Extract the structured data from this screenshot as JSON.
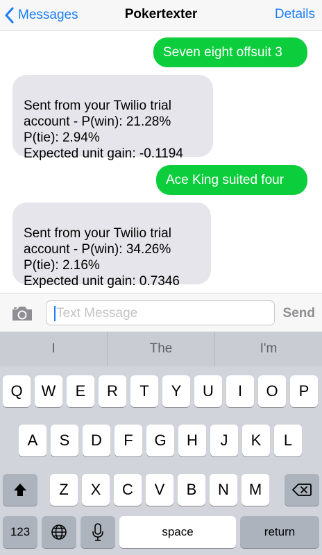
{
  "navbar": {
    "back_label": "Messages",
    "title": "Pokertexter",
    "details_label": "Details"
  },
  "messages": [
    {
      "direction": "outgoing",
      "text": "Seven eight offsuit 3"
    },
    {
      "direction": "incoming",
      "text": "Sent from your Twilio trial\naccount - P(win): 21.28%\nP(tie): 2.94%\nExpected unit gain: -0.1194"
    },
    {
      "direction": "outgoing",
      "text": "Ace King suited four"
    },
    {
      "direction": "incoming",
      "text": "Sent from your Twilio trial\naccount - P(win): 34.26%\nP(tie): 2.16%\nExpected unit gain: 0.7346"
    }
  ],
  "input": {
    "placeholder": "Text Message",
    "send_label": "Send",
    "camera_icon": "camera-icon"
  },
  "keyboard": {
    "predictions": [
      "I",
      "The",
      "I'm"
    ],
    "row1": [
      "Q",
      "W",
      "E",
      "R",
      "T",
      "Y",
      "U",
      "I",
      "O",
      "P"
    ],
    "row2": [
      "A",
      "S",
      "D",
      "F",
      "G",
      "H",
      "J",
      "K",
      "L"
    ],
    "row3": [
      "Z",
      "X",
      "C",
      "V",
      "B",
      "N",
      "M"
    ],
    "numbers_label": "123",
    "space_label": "space",
    "return_label": "return",
    "shift_icon": "shift-icon",
    "delete_icon": "delete-icon",
    "globe_icon": "globe-icon",
    "mic_icon": "microphone-icon"
  },
  "colors": {
    "ios_blue": "#1a7dfc",
    "outgoing_bubble": "#0ccd3c",
    "incoming_bubble": "#e6e5eb",
    "keyboard_bg": "#d1d5db"
  }
}
